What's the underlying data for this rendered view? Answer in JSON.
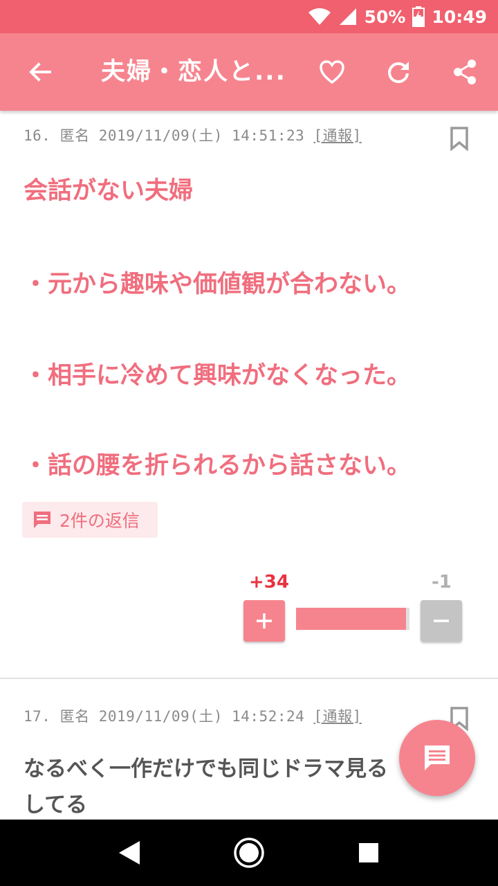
{
  "status_bar": {
    "battery": "50%",
    "time": "10:49",
    "icons": [
      "wifi-icon",
      "signal-icon",
      "battery-charging-icon"
    ]
  },
  "app_bar": {
    "title": "夫婦・恋人と...",
    "icons": [
      "back-arrow-icon",
      "heart-icon",
      "refresh-icon",
      "share-icon"
    ]
  },
  "posts": [
    {
      "number": "16.",
      "author": "匿名",
      "date": "2019/11/09(土)",
      "time": "14:51:23",
      "report": "[通報]",
      "lines": [
        "会話がない夫婦",
        "・元から趣味や価値観が合わない。",
        "・相手に冷めて興味がなくなった。",
        "・話の腰を折られるから話さない。"
      ],
      "replies": "2件の返信",
      "plus_count": "+34",
      "minus_count": "-1",
      "plus_ratio": 0.97
    },
    {
      "number": "17.",
      "author": "匿名",
      "date": "2019/11/09(土)",
      "time": "14:52:24",
      "report": "[通報]",
      "lines": [
        "なるべく一作だけでも同じドラマ見る",
        "してる"
      ]
    }
  ],
  "colors": {
    "status_bar": "#f0606e",
    "app_bar": "#f6848e",
    "accent_text": "#f06e7e",
    "plus_count": "#e8323f"
  }
}
